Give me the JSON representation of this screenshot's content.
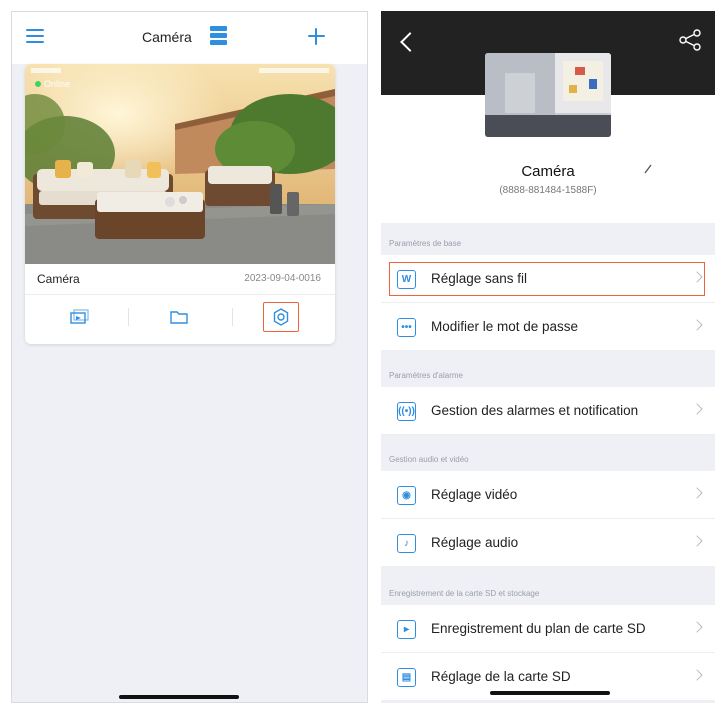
{
  "left": {
    "header": {
      "title": "Caméra",
      "menu_icon": "menu-icon",
      "view_icon": "grid-view-icon",
      "add_icon": "plus-icon"
    },
    "camera_card": {
      "status": "Online",
      "name": "Caméra",
      "date": "2023-09-04-0016",
      "buttons": [
        {
          "icon": "playback-icon"
        },
        {
          "icon": "folder-icon"
        },
        {
          "icon": "settings-icon"
        }
      ]
    }
  },
  "right": {
    "header": {
      "back_icon": "back-icon",
      "share_icon": "share-icon"
    },
    "device": {
      "name": "Caméra",
      "id": "(8888-881484-1588F)"
    },
    "sections": [
      {
        "title": "Paramètres de base",
        "items": [
          {
            "label": "Réglage sans fil",
            "icon": "wifi-icon"
          },
          {
            "label": "Modifier le mot de passe",
            "icon": "password-icon"
          }
        ]
      },
      {
        "title": "Paramètres d'alarme",
        "items": [
          {
            "label": "Gestion des alarmes et notification",
            "icon": "alarm-icon"
          }
        ]
      },
      {
        "title": "Gestion audio et vidéo",
        "items": [
          {
            "label": "Réglage vidéo",
            "icon": "video-icon"
          },
          {
            "label": "Réglage audio",
            "icon": "audio-icon"
          }
        ]
      },
      {
        "title": "Enregistrement de la carte SD et stockage",
        "items": [
          {
            "label": "Enregistrement du plan de carte SD",
            "icon": "sd-schedule-icon"
          },
          {
            "label": "Réglage de la carte SD",
            "icon": "sd-card-icon"
          }
        ]
      }
    ]
  },
  "colors": {
    "accent": "#2f8ee0",
    "highlight": "#f0623a",
    "online": "#3fd55a",
    "hero_background": "#222222",
    "page_background": "#eef0f5"
  }
}
